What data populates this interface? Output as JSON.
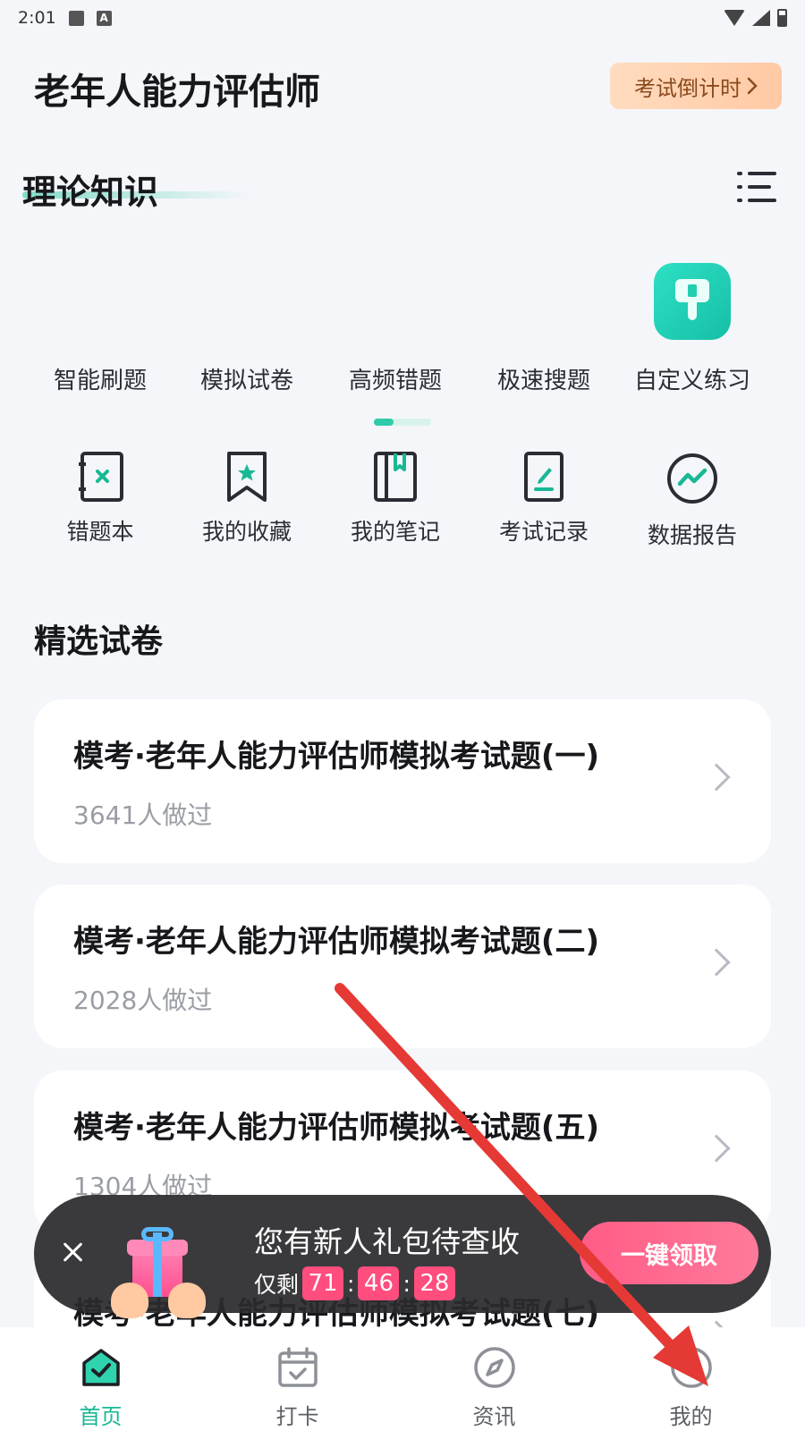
{
  "status": {
    "time": "2:01"
  },
  "header": {
    "title": "老年人能力评估师",
    "countdown_label": "考试倒计时"
  },
  "theory": {
    "title": "理论知识"
  },
  "features": [
    {
      "label": "智能刷题"
    },
    {
      "label": "模拟试卷"
    },
    {
      "label": "高频错题"
    },
    {
      "label": "极速搜题"
    },
    {
      "label": "自定义练习",
      "icon": "pushpin-icon"
    }
  ],
  "tools": [
    {
      "label": "错题本",
      "icon": "wrong-book-icon"
    },
    {
      "label": "我的收藏",
      "icon": "bookmark-star-icon"
    },
    {
      "label": "我的笔记",
      "icon": "notebook-icon"
    },
    {
      "label": "考试记录",
      "icon": "exam-record-icon"
    },
    {
      "label": "数据报告",
      "icon": "trend-chart-icon"
    }
  ],
  "papers": {
    "title": "精选试卷",
    "items": [
      {
        "title": "模考·老年人能力评估师模拟考试题(一)",
        "meta": "3641人做过"
      },
      {
        "title": "模考·老年人能力评估师模拟考试题(二)",
        "meta": "2028人做过"
      },
      {
        "title": "模考·老年人能力评估师模拟考试题(五)",
        "meta": "1304人做过"
      },
      {
        "title": "模考·老年人能力评估师模拟考试题(七)",
        "meta": ""
      }
    ]
  },
  "gift": {
    "message": "您有新人礼包待查收",
    "remaining_label": "仅剩",
    "hours": "71",
    "minutes": "46",
    "seconds": "28",
    "separator": ":",
    "claim_label": "一键领取"
  },
  "tabbar": [
    {
      "label": "首页",
      "active": true
    },
    {
      "label": "打卡",
      "active": false
    },
    {
      "label": "资讯",
      "active": false
    },
    {
      "label": "我的",
      "active": false
    }
  ],
  "colors": {
    "accent": "#18b895",
    "claim": "#ff5c86",
    "countdown_bg": "#ffd1ae",
    "annotation_arrow": "#e53935"
  }
}
